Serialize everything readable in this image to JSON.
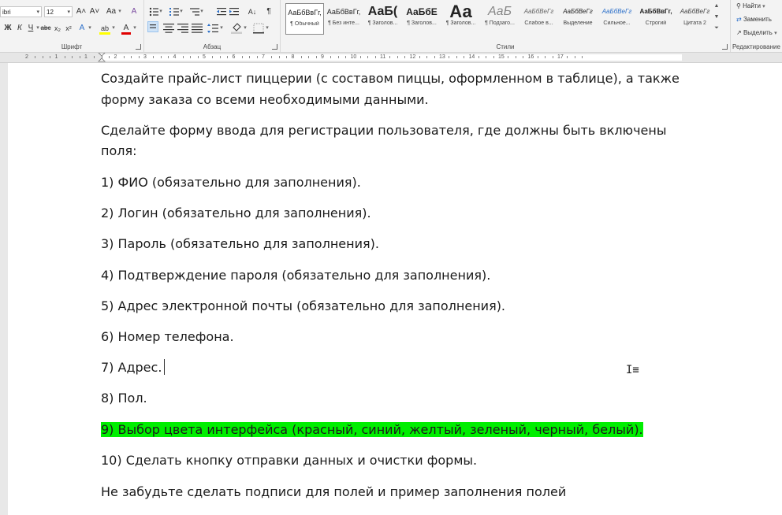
{
  "ribbon": {
    "font_group": {
      "label": "Шрифт",
      "font_name": "ibri",
      "font_size": "12",
      "grow_font": "A˄",
      "shrink_font": "A˅",
      "change_case": "Aa",
      "clear_format": "A",
      "bold": "Ж",
      "italic": "К",
      "underline": "Ч",
      "strike": "abc",
      "subscript": "x₂",
      "superscript": "x²",
      "text_effects": "A",
      "highlight": "ab",
      "font_color": "A"
    },
    "paragraph_group": {
      "label": "Абзац",
      "sort": "A↓",
      "pilcrow": "¶"
    },
    "styles_group": {
      "label": "Стили",
      "items": [
        {
          "preview": "АаБбВвГг,",
          "name": "¶ Обычный"
        },
        {
          "preview": "АаБбВвГг,",
          "name": "¶ Без инте..."
        },
        {
          "preview": "АаБ(",
          "name": "¶ Заголов..."
        },
        {
          "preview": "АаБбЕ",
          "name": "¶ Заголов..."
        },
        {
          "preview": "Аа",
          "name": "¶ Заголов..."
        },
        {
          "preview": "АаБ",
          "name": "¶ Подзаго..."
        },
        {
          "preview": "АаБбВеГг",
          "name": "Слабое в..."
        },
        {
          "preview": "АаБбВеГг",
          "name": "Выделение"
        },
        {
          "preview": "АаБбВеГг",
          "name": "Сильное..."
        },
        {
          "preview": "АаБбВвГг,",
          "name": "Строгий"
        },
        {
          "preview": "АаБбВеГг",
          "name": "Цитата 2"
        }
      ]
    },
    "editing_group": {
      "label": "Редактирование",
      "find": "Найти",
      "replace": "Заменить",
      "select": "Выделить"
    }
  },
  "ruler": {
    "numbers": [
      "2",
      "1",
      "1",
      "2",
      "3",
      "4",
      "5",
      "6",
      "7",
      "8",
      "9",
      "10",
      "11",
      "12",
      "13",
      "14",
      "15",
      "16",
      "17"
    ]
  },
  "document": {
    "paragraphs": [
      {
        "text": "Создайте прайс-лист пиццерии (с составом пиццы, оформленном в таблице), а также"
      },
      {
        "text": "форму заказа со всеми необходимыми данными."
      },
      {
        "text": "Сделайте форму ввода для регистрации пользователя, где должны быть включены"
      },
      {
        "text": "поля:"
      },
      {
        "text": "1) ФИО (обязательно для заполнения)."
      },
      {
        "text": "2) Логин (обязательно для заполнения)."
      },
      {
        "text": "3) Пароль (обязательно для заполнения)."
      },
      {
        "text": "4) Подтверждение пароля (обязательно для заполнения)."
      },
      {
        "text": "5) Адрес электронной почты (обязательно для заполнения)."
      },
      {
        "text": "6) Номер телефона."
      },
      {
        "text": "7) Адрес."
      },
      {
        "text": "8) Пол."
      },
      {
        "text": "9) Выбор цвета интерфейса (красный, синий, желтый, зеленый, черный, белый)."
      },
      {
        "text": "10) Сделать кнопку отправки данных и очистки формы."
      },
      {
        "text": "Не забудьте сделать подписи для полей и пример заполнения полей"
      }
    ],
    "highlight_color": "#00ee00"
  }
}
